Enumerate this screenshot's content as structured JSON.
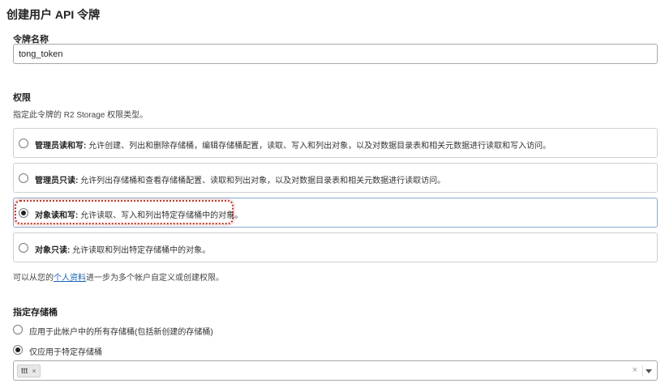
{
  "page": {
    "title": "创建用户 API 令牌"
  },
  "token_name": {
    "label": "令牌名称",
    "value": "tong_token"
  },
  "permissions": {
    "label": "权限",
    "description": "指定此令牌的 R2 Storage 权限类型。",
    "options": [
      {
        "title": "管理员读和写:",
        "desc": " 允许创建、列出和删除存储桶，编辑存储桶配置，读取、写入和列出对象，以及对数据目录表和相关元数据进行读取和写入访问。",
        "selected": false
      },
      {
        "title": "管理员只读:",
        "desc": " 允许列出存储桶和查看存储桶配置、读取和列出对象，以及对数据目录表和相关元数据进行读取访问。",
        "selected": false
      },
      {
        "title": "对象读和写:",
        "desc": " 允许读取、写入和列出特定存储桶中的对象。",
        "selected": true
      },
      {
        "title": "对象只读:",
        "desc": " 允许读取和列出特定存储桶中的对象。",
        "selected": false
      }
    ],
    "profile_prefix": "可以从您的",
    "profile_link": "个人资料",
    "profile_suffix": "进一步为多个帐户自定义或创建权限。"
  },
  "buckets": {
    "label": "指定存储桶",
    "options": [
      {
        "label": "应用于此帐户中的所有存储桶(包括新创建的存储桶)",
        "selected": false
      },
      {
        "label": "仅应用于特定存储桶",
        "selected": true
      }
    ],
    "selected_chip": "ttt",
    "chip_remove": "×",
    "clear": "×"
  },
  "colors": {
    "highlight": "#c0392b",
    "link": "#1b65b5",
    "selected_border": "#8aa9cf"
  },
  "icons": {
    "chip_remove": "close-icon",
    "clear": "close-icon",
    "dropdown": "chevron-down-icon"
  }
}
